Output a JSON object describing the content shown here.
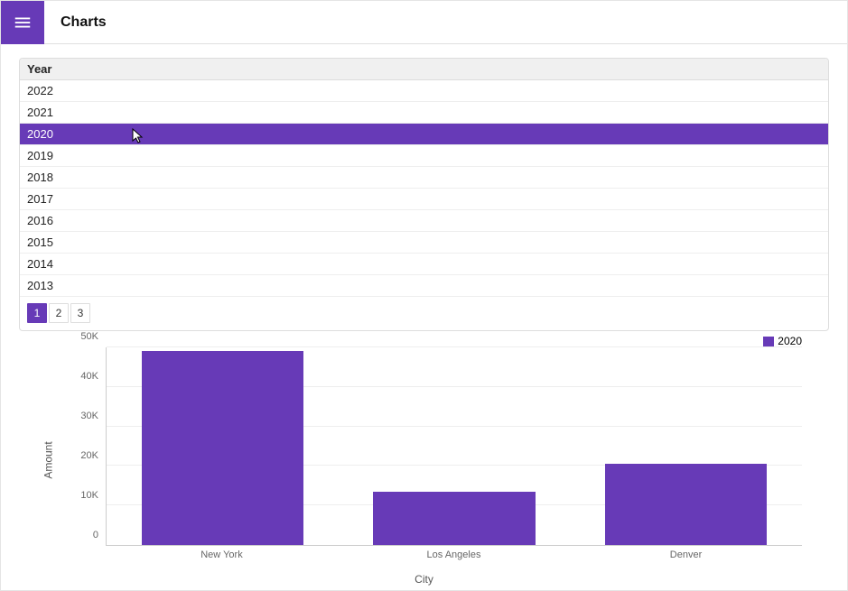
{
  "topbar": {
    "title": "Charts"
  },
  "grid": {
    "header": "Year",
    "rows": [
      "2022",
      "2021",
      "2020",
      "2019",
      "2018",
      "2017",
      "2016",
      "2015",
      "2014",
      "2013"
    ],
    "selected_index": 2
  },
  "pager": {
    "pages": [
      "1",
      "2",
      "3"
    ],
    "current_index": 0
  },
  "legend": {
    "label": "2020",
    "color": "#673ab7"
  },
  "axes": {
    "y_title": "Amount",
    "x_title": "City"
  },
  "chart_data": {
    "type": "bar",
    "categories": [
      "New York",
      "Los Angeles",
      "Denver"
    ],
    "values": [
      49000,
      13500,
      20500
    ],
    "title": "",
    "xlabel": "City",
    "ylabel": "Amount",
    "ylim": [
      0,
      50000
    ],
    "y_ticks": [
      "0",
      "10K",
      "20K",
      "30K",
      "40K",
      "50K"
    ],
    "series_name": "2020",
    "color": "#673ab7"
  }
}
